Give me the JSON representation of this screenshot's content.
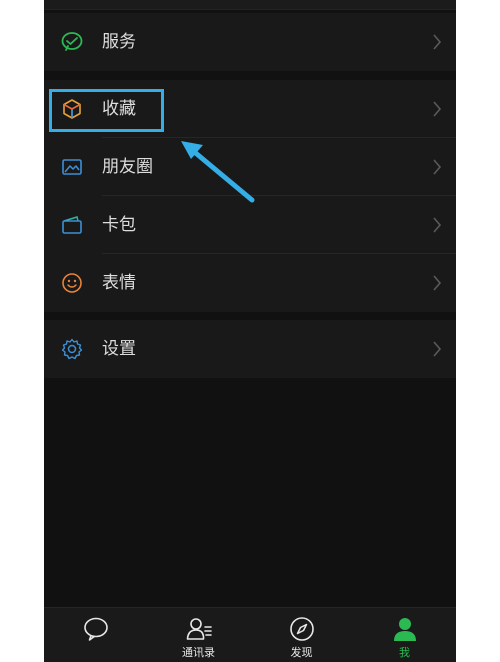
{
  "menu": {
    "services": {
      "label": "服务",
      "icon": "wechat-pay-icon"
    },
    "favorites": {
      "label": "收藏",
      "icon": "cube-icon"
    },
    "moments": {
      "label": "朋友圈",
      "icon": "photo-icon"
    },
    "cards": {
      "label": "卡包",
      "icon": "wallet-icon"
    },
    "stickers": {
      "label": "表情",
      "icon": "smile-icon"
    },
    "settings": {
      "label": "设置",
      "icon": "gear-icon"
    }
  },
  "tabbar": {
    "chats": {
      "label": "",
      "icon": "chat-bubble-icon"
    },
    "contacts": {
      "label": "通讯录",
      "icon": "contacts-icon"
    },
    "discover": {
      "label": "发现",
      "icon": "compass-icon"
    },
    "me": {
      "label": "我",
      "icon": "person-icon",
      "active": true
    }
  },
  "colors": {
    "background": "#111111",
    "row": "#191919",
    "text": "#dedede",
    "accent_green": "#2bb954",
    "highlight_blue": "#35aee8"
  }
}
